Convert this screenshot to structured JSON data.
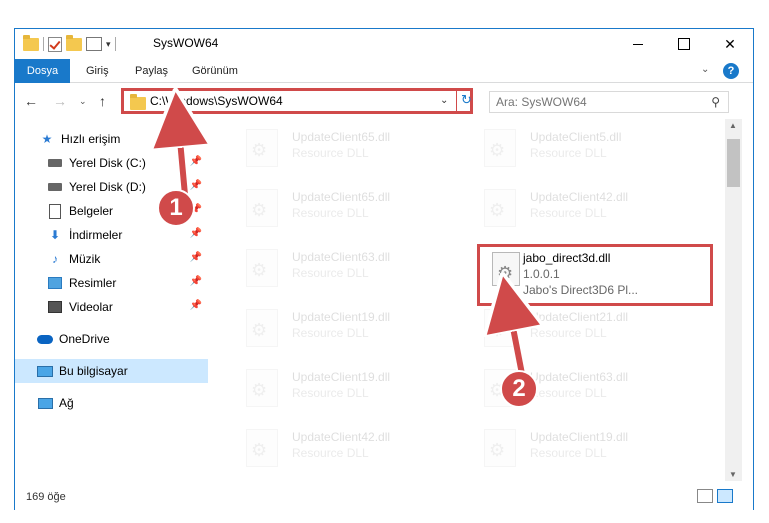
{
  "window": {
    "title": "SysWOW64",
    "qat_dropdown": "▾",
    "minimize": "",
    "maximize": "",
    "close": "✕"
  },
  "ribbon": {
    "tabs": [
      "Dosya",
      "Giriş",
      "Paylaş",
      "Görünüm"
    ],
    "expand": "⌄",
    "help": "?"
  },
  "nav": {
    "back": "←",
    "forward": "→",
    "recent": "⌄",
    "up": "↑",
    "address": "C:\\Windows\\SysWOW64",
    "address_dropdown": "⌄",
    "refresh": "↻",
    "search_placeholder": "Ara: SysWOW64",
    "search_icon": "⚲"
  },
  "sidebar": {
    "items": [
      {
        "label": "Hızlı erişim",
        "icon": "star-icon"
      },
      {
        "label": "Yerel Disk (C:)",
        "icon": "disk-icon",
        "pinned": true
      },
      {
        "label": "Yerel Disk (D:)",
        "icon": "disk-icon",
        "pinned": true
      },
      {
        "label": "Belgeler",
        "icon": "document-icon",
        "pinned": true
      },
      {
        "label": "İndirmeler",
        "icon": "download-icon",
        "pinned": true
      },
      {
        "label": "Müzik",
        "icon": "music-icon",
        "pinned": true
      },
      {
        "label": "Resimler",
        "icon": "pictures-icon",
        "pinned": true
      },
      {
        "label": "Videolar",
        "icon": "videos-icon",
        "pinned": true
      },
      {
        "label": "OneDrive",
        "icon": "cloud-icon"
      },
      {
        "label": "Bu bilgisayar",
        "icon": "computer-icon",
        "selected": true
      },
      {
        "label": "Ağ",
        "icon": "network-icon"
      }
    ],
    "pin_glyph": "📌"
  },
  "files": {
    "left": [
      {
        "name": "UpdateClient65.dll",
        "type": "Resource DLL"
      },
      {
        "name": "UpdateClient65.dll",
        "type": "Resource DLL"
      },
      {
        "name": "UpdateClient63.dll",
        "type": "Resource DLL"
      },
      {
        "name": "UpdateClient19.dll",
        "type": "Resource DLL"
      },
      {
        "name": "UpdateClient19.dll",
        "type": "Resource DLL"
      },
      {
        "name": "UpdateClient42.dll",
        "type": "Resource DLL"
      }
    ],
    "right": [
      {
        "name": "UpdateClient5.dll",
        "type": "Resource DLL"
      },
      {
        "name": "UpdateClient42.dll",
        "type": "Resource DLL"
      },
      {
        "name": "UpdateClient21.dll",
        "type": "Resource DLL"
      },
      {
        "name": "UpdateClient63.dll",
        "type": "Resource DLL"
      },
      {
        "name": "UpdateClient19.dll",
        "type": "Resource DLL"
      }
    ],
    "highlighted": {
      "name": "jabo_direct3d.dll",
      "version": "1.0.0.1",
      "description": "Jabo's Direct3D6 Pl..."
    }
  },
  "status": {
    "item_count": "169 öğe"
  },
  "annotations": {
    "step1": "1",
    "step2": "2",
    "color": "#d04a4a"
  }
}
